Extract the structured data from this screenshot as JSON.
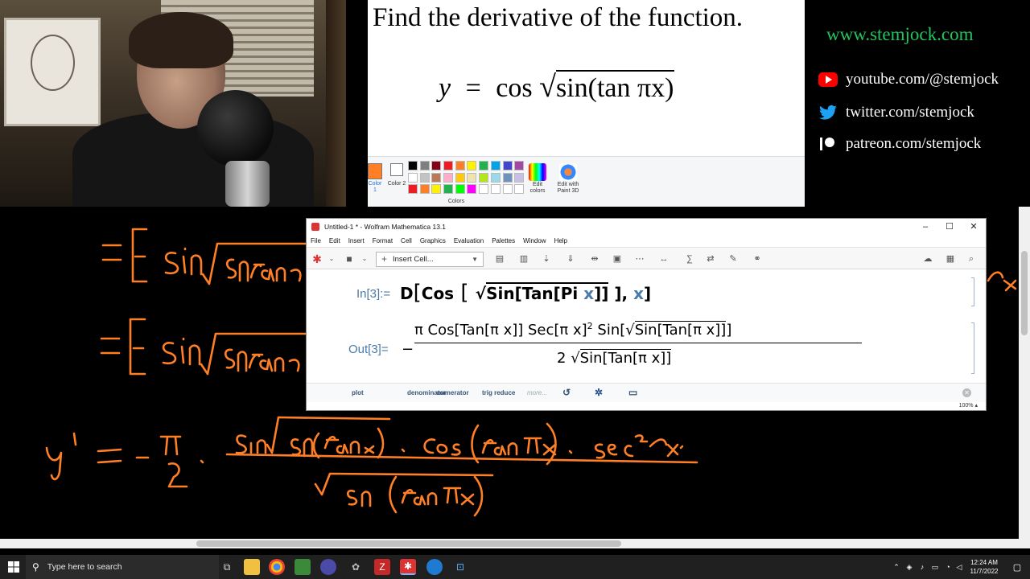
{
  "paint": {
    "title": "Find the derivative of the function.",
    "formula_lhs": "y",
    "formula_eq": "=",
    "formula_cos": "cos",
    "formula_radicand": "sin(tan πx)",
    "color1_label": "Color 1",
    "color2_label": "Color 2",
    "colors_label": "Colors",
    "edit_colors_label": "Edit colors",
    "edit_paint3d_label": "Edit with Paint 3D",
    "palette": [
      "#000000",
      "#7f7f7f",
      "#880015",
      "#ed1c24",
      "#ff7f27",
      "#fff200",
      "#22b14c",
      "#00a2e8",
      "#3f48cc",
      "#a349a4",
      "#ffffff",
      "#c3c3c3",
      "#b97a57",
      "#ffaec9",
      "#ffc90e",
      "#efe4b0",
      "#b5e61d",
      "#99d9ea",
      "#7092be",
      "#c8bfe7",
      "#ed1c24",
      "#ff7f27",
      "#fff200",
      "#22b14c",
      "#00ff00",
      "#ff00ff",
      "#ffffff",
      "#ffffff",
      "#ffffff",
      "#ffffff"
    ]
  },
  "social": {
    "site": "www.stemjock.com",
    "youtube": "youtube.com/@stemjock",
    "twitter": "twitter.com/stemjock",
    "patreon": "patreon.com/stemjock",
    "youtube_icon": "youtube-icon",
    "twitter_icon": "twitter-icon",
    "patreon_icon": "patreon-icon",
    "site_color": "#22c55e"
  },
  "mathematica": {
    "window_title": "Untitled-1 * - Wolfram Mathematica 13.1",
    "menu": [
      "File",
      "Edit",
      "Insert",
      "Format",
      "Cell",
      "Graphics",
      "Evaluation",
      "Palettes",
      "Window",
      "Help"
    ],
    "insert_cell": "Insert Cell...",
    "in_label": "In[3]:=",
    "in_code_1": "D",
    "in_code_2": "Cos",
    "in_code_3": "Sin[Tan[Pi",
    "in_code_x": "x",
    "in_code_4": "]]",
    "in_code_5": "],",
    "in_code_x2": "x",
    "in_code_6": "]",
    "out_label": "Out[3]=",
    "out_minus": "−",
    "out_numerator": "π Cos[Tan[π x]] Sec[π x]",
    "out_num_exp": "2",
    "out_numerator_2": "Sin[",
    "out_num_rad": "Sin[Tan[π x]]",
    "out_numerator_3": "]",
    "out_den_2": "2",
    "out_den_rad": "Sin[Tan[π x]]",
    "suggestions": [
      "plot",
      "denominator",
      "numerator",
      "trig reduce",
      "more..."
    ],
    "zoom": "100%"
  },
  "handwriting": {
    "color": "#ff7f27"
  },
  "taskbar": {
    "search_placeholder": "Type here to search",
    "time": "12:24 AM",
    "date": "11/7/2022"
  }
}
